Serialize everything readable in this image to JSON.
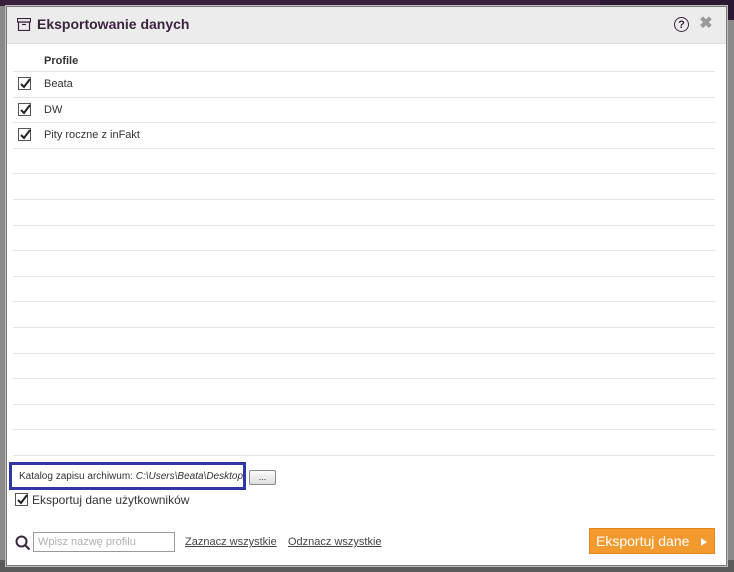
{
  "dialog": {
    "title": "Eksportowanie danych",
    "help_glyph": "?",
    "close_glyph": "✖"
  },
  "profiles": {
    "column_header": "Profile",
    "rows": [
      {
        "label": "Beata",
        "checked": true
      },
      {
        "label": "DW",
        "checked": true
      },
      {
        "label": "Pity roczne z inFakt",
        "checked": true
      },
      {
        "label": "",
        "checked": false
      },
      {
        "label": "",
        "checked": false
      },
      {
        "label": "",
        "checked": false
      },
      {
        "label": "",
        "checked": false
      },
      {
        "label": "",
        "checked": false
      },
      {
        "label": "",
        "checked": false
      },
      {
        "label": "",
        "checked": false
      },
      {
        "label": "",
        "checked": false
      },
      {
        "label": "",
        "checked": false
      },
      {
        "label": "",
        "checked": false
      },
      {
        "label": "",
        "checked": false
      },
      {
        "label": "",
        "checked": false
      }
    ]
  },
  "catalog": {
    "label": "Katalog zapisu archiwum:",
    "path": "C:\\Users\\Beata\\Desktop",
    "browse_label": "..."
  },
  "export_users": {
    "label": "Eksportuj dane użytkowników",
    "checked": true
  },
  "footer": {
    "search_placeholder": "Wpisz nazwę profilu",
    "select_all": "Zaznacz wszystkie",
    "deselect_all": "Odznacz wszystkie",
    "export_button": "Eksportuj dane"
  },
  "colors": {
    "accent": "#f29a2e",
    "title": "#3c2340",
    "highlight_border": "#3036a8"
  }
}
